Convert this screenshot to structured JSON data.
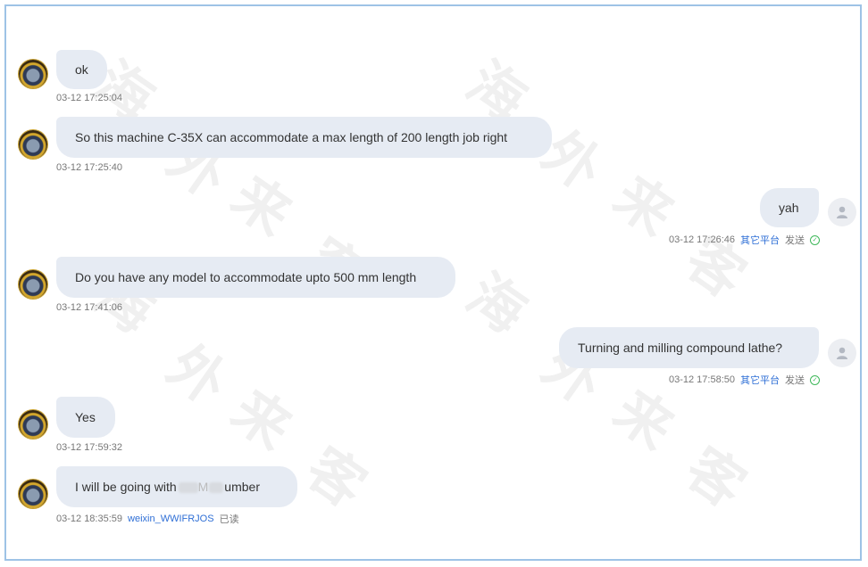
{
  "messages": [
    {
      "text": "ok",
      "time": "03-12 17:25:04"
    },
    {
      "text": "So this machine C-35X can accommodate a max length of 200 length job right",
      "time": "03-12 17:25:40"
    },
    {
      "text": "yah",
      "time": "03-12 17:26:46",
      "platform": "其它平台",
      "status": "发送"
    },
    {
      "text": "Do you have any model to accommodate upto 500 mm length",
      "time": "03-12 17:41:06"
    },
    {
      "text": "Turning and milling compound lathe?",
      "time": "03-12 17:58:50",
      "platform": "其它平台",
      "status": "发送"
    },
    {
      "text": "Yes",
      "time": "03-12 17:59:32"
    },
    {
      "text_start": "I will be going with",
      "text_mid": "M",
      "text_end": "umber",
      "time": "03-12 18:35:59",
      "sender": "weixin_WWIFRJOS",
      "status": "已读"
    }
  ],
  "watermark": [
    "海",
    "外",
    "来",
    "客"
  ],
  "colors": {
    "bubble": "#e6ebf3",
    "link": "#2f6fd6",
    "check": "#3fb85a",
    "frame": "#9ec3e6"
  }
}
